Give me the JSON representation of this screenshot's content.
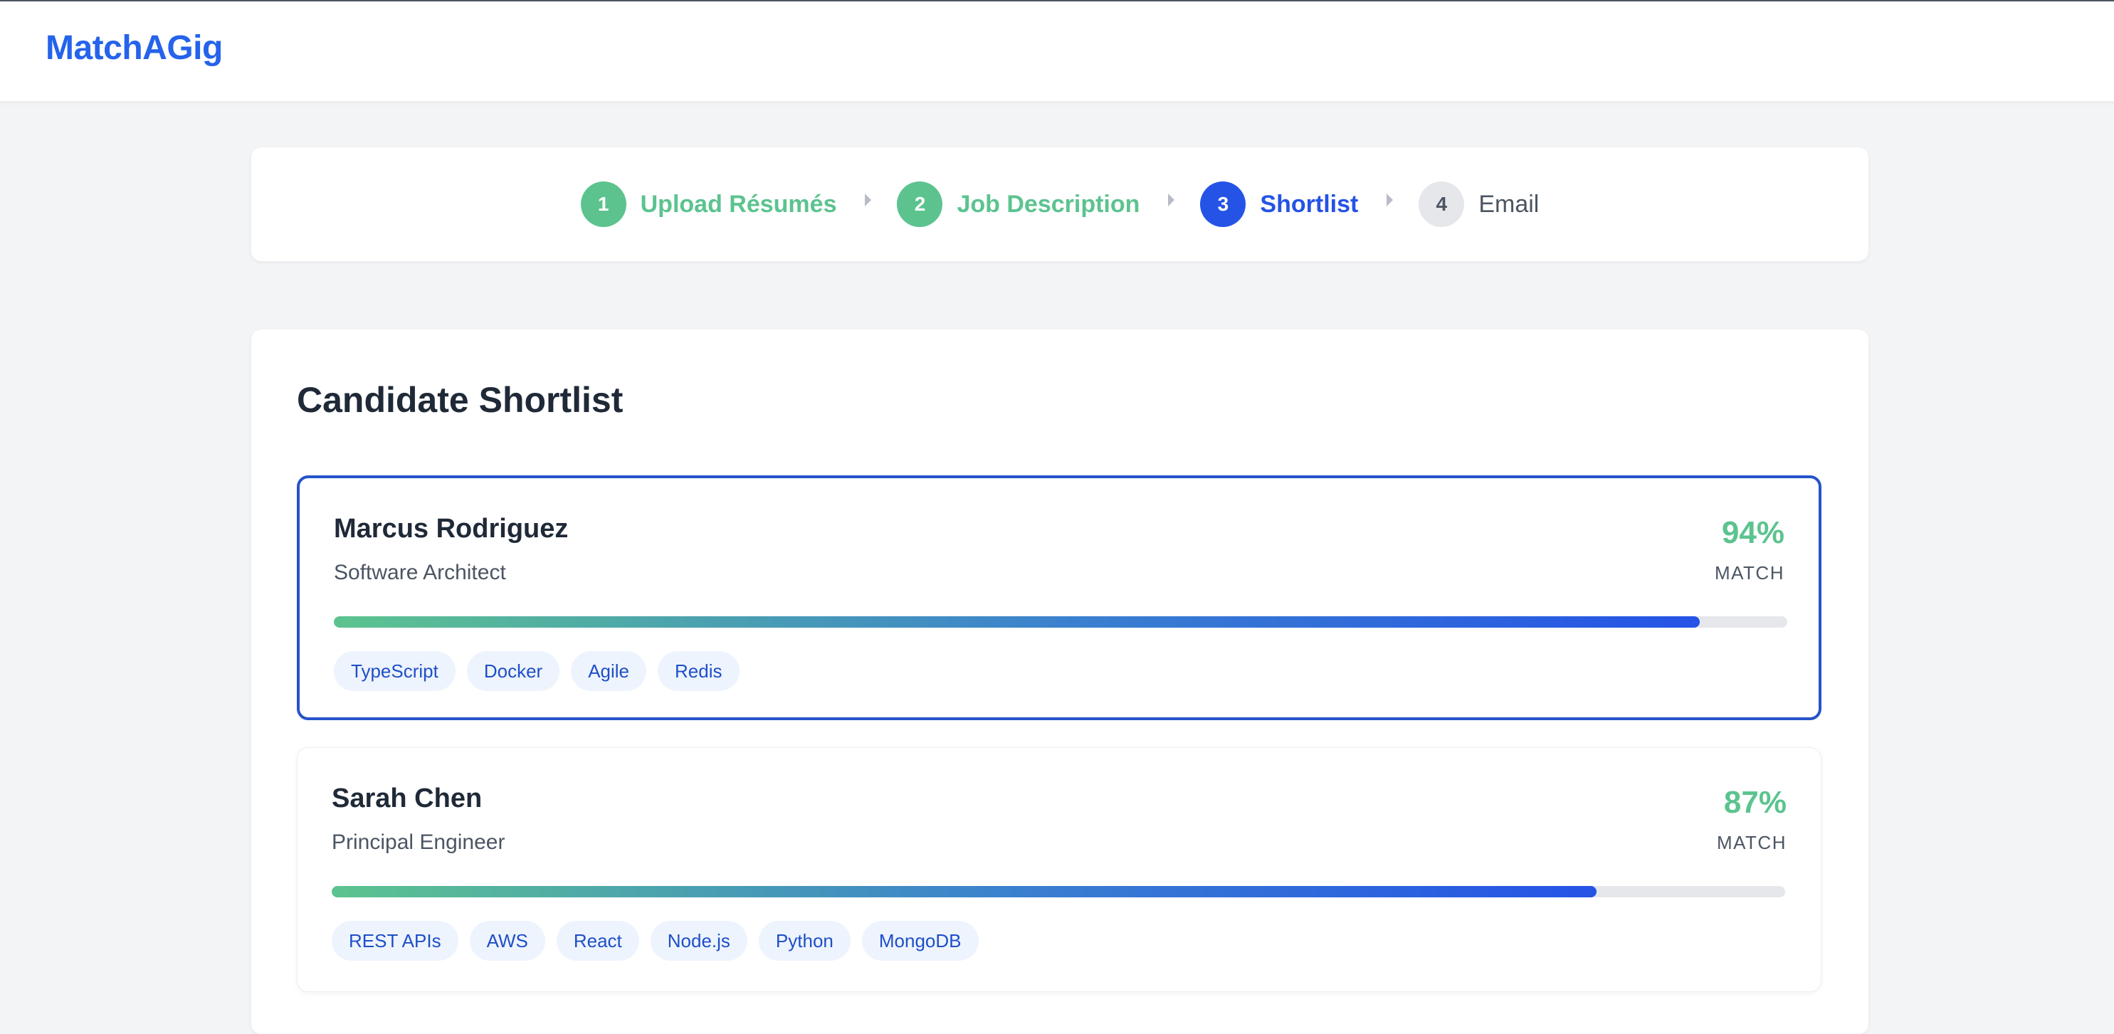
{
  "app": {
    "logo": "MatchAGig"
  },
  "steps": [
    {
      "num": "1",
      "label": "Upload Résumés",
      "state": "done"
    },
    {
      "num": "2",
      "label": "Job Description",
      "state": "done"
    },
    {
      "num": "3",
      "label": "Shortlist",
      "state": "active"
    },
    {
      "num": "4",
      "label": "Email",
      "state": "todo"
    }
  ],
  "shortlist": {
    "title": "Candidate Shortlist",
    "candidates": [
      {
        "name": "Marcus Rodriguez",
        "role": "Software Architect",
        "match_pct": "94%",
        "match_label": "MATCH",
        "match_value": 0.94,
        "selected": true,
        "skills": [
          "TypeScript",
          "Docker",
          "Agile",
          "Redis"
        ]
      },
      {
        "name": "Sarah Chen",
        "role": "Principal Engineer",
        "match_pct": "87%",
        "match_label": "MATCH",
        "match_value": 0.87,
        "selected": false,
        "skills": [
          "REST APIs",
          "AWS",
          "React",
          "Node.js",
          "Python",
          "MongoDB"
        ]
      }
    ]
  },
  "colors": {
    "brand": "#2563eb",
    "done": "#5cc38f",
    "active": "#2553e6",
    "todo": "#e5e7eb",
    "tag_bg": "#eef4fd",
    "tag_text": "#1e4fc8"
  }
}
